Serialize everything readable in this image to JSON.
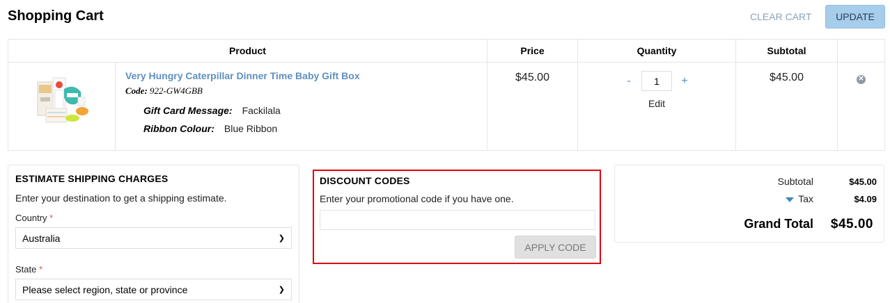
{
  "header": {
    "title": "Shopping Cart",
    "clear_cart": "CLEAR CART",
    "update": "UPDATE"
  },
  "table": {
    "headers": {
      "product": "Product",
      "price": "Price",
      "quantity": "Quantity",
      "subtotal": "Subtotal"
    }
  },
  "item": {
    "name": "Very Hungry Caterpillar Dinner Time Baby Gift Box",
    "code_label": "Code:",
    "code": "922-GW4GBB",
    "options": [
      {
        "label": "Gift Card Message:",
        "value": "Fackilala"
      },
      {
        "label": "Ribbon Colour:",
        "value": "Blue Ribbon"
      }
    ],
    "price": "$45.00",
    "qty": "1",
    "qty_minus": "-",
    "qty_plus": "+",
    "edit": "Edit",
    "subtotal": "$45.00",
    "remove_icon": "close-circle-icon"
  },
  "shipping": {
    "title": "ESTIMATE SHIPPING CHARGES",
    "desc": "Enter your destination to get a shipping estimate.",
    "country_label": "Country",
    "country_value": "Australia",
    "state_label": "State",
    "state_value": "Please select region, state or province",
    "required_mark": "*"
  },
  "discount": {
    "title": "DISCOUNT CODES",
    "desc": "Enter your promotional code if you have one.",
    "input_value": "",
    "apply": "APPLY CODE"
  },
  "totals": {
    "subtotal_label": "Subtotal",
    "subtotal": "$45.00",
    "tax_label": "Tax",
    "tax": "$4.09",
    "grand_label": "Grand Total",
    "grand": "$45.00"
  },
  "colors": {
    "link": "#5f8fbf",
    "update_button": "#a6cdec",
    "highlight_outline": "#e0000f"
  }
}
